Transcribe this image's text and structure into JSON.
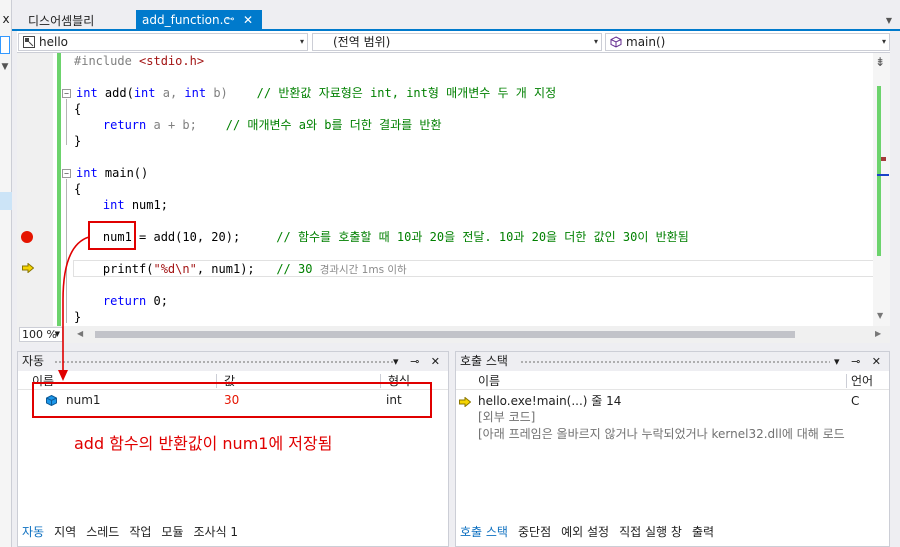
{
  "left_stub": {
    "close_glyph": "x"
  },
  "tabs": {
    "inactive_label": "디스어셈블리",
    "active_label": "add_function.c",
    "pin_glyph": "⊸",
    "close_glyph": "✕",
    "overflow_glyph": "▼"
  },
  "nav": {
    "project": "hello",
    "scope": "(전역 범위)",
    "member": "main()",
    "arrow": "▾"
  },
  "code": {
    "l1_include": "#include ",
    "l1_header": "<stdio.h>",
    "l3_int": "int",
    "l3_sig": " add(",
    "l3_int2": "int",
    "l3_a": " a, ",
    "l3_int3": "int",
    "l3_b": " b)    ",
    "l3_comment": "// 반환값 자료형은 int, int형 매개변수 두 개 지정",
    "l4": "{",
    "l5_indent": "    ",
    "l5_return": "return",
    "l5_expr": " a + b;    ",
    "l5_comment": "// 매개변수 a와 b를 더한 결과를 반환",
    "l6": "}",
    "l8_int": "int",
    "l8_rest": " main()",
    "l9": "{",
    "l10_indent": "    ",
    "l10_int": "int",
    "l10_rest": " num1;",
    "l12_code": "    num1 = add(10, 20);     ",
    "l12_comment": "// 함수를 호출할 때 10과 20을 전달. 10과 20을 더한 값인 30이 반환됨",
    "l14_code": "    printf(",
    "l14_str": "\"%d\\n\"",
    "l14_rest": ", num1);   ",
    "l14_comment": "// 30",
    "l14_hint": "경과시간 1ms 이하",
    "l16_indent": "    ",
    "l16_return": "return",
    "l16_rest": " 0;",
    "l17": "}"
  },
  "editor": {
    "split_glyph": "⇟",
    "down_glyph": "▼"
  },
  "zoom": {
    "level": "100 %",
    "left_glyph": "◀",
    "right_glyph": "▶"
  },
  "autos": {
    "title": "자동",
    "title_buttons": "▾ ⊸ ✕",
    "col_name": "이름",
    "col_value": "값",
    "col_type": "형식",
    "var_name": "num1",
    "var_value": "30",
    "var_type": "int",
    "tabs": [
      "자동",
      "지역",
      "스레드",
      "작업",
      "모듈",
      "조사식 1"
    ]
  },
  "annotation": {
    "note": "add 함수의 반환값이 num1에 저장됨"
  },
  "callstack": {
    "title": "호출 스택",
    "title_buttons": "▾ ⊸ ✕",
    "col_name": "이름",
    "col_lang": "언어",
    "rows": [
      {
        "name": "hello.exe!main(...) 줄 14",
        "lang": "C"
      },
      {
        "name": "[외부 코드]",
        "lang": ""
      },
      {
        "name": "[아래 프레임은 올바르지 않거나 누락되었거나 kernel32.dll에 대해 로드",
        "lang": ""
      }
    ],
    "tabs": [
      "호출 스택",
      "중단점",
      "예외 설정",
      "직접 실행 창",
      "출력"
    ]
  },
  "colors": {
    "accent": "#007acc",
    "breakpoint": "#e51400",
    "annotation": "#e00000",
    "keyword": "#0000ff",
    "comment": "#008000",
    "string": "#a31515"
  }
}
